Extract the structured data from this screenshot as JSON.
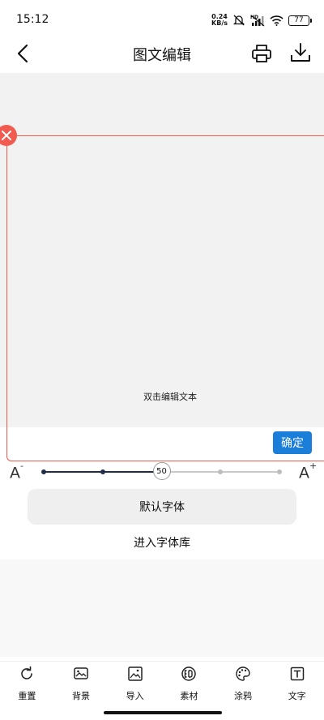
{
  "status_bar": {
    "time": "15:12",
    "net_speed_value": "0.24",
    "net_speed_unit": "KB/s",
    "battery": "77"
  },
  "header": {
    "title": "图文编辑",
    "icons": [
      "back-arrow-icon",
      "printer-icon",
      "download-icon"
    ]
  },
  "canvas": {
    "placeholder_text": "双击编辑文本",
    "border_color": "#ef5a4c",
    "background": "#f2f2f2"
  },
  "confirm_label": "确定",
  "font_size": {
    "value": 50,
    "min": 0,
    "max": 100,
    "ticks": [
      0,
      25,
      50,
      75,
      100
    ],
    "decrease_label": "A",
    "decrease_mark": "-",
    "increase_label": "A",
    "increase_mark": "+"
  },
  "font": {
    "current_label": "默认字体",
    "library_link": "进入字体库"
  },
  "toolbar": {
    "items": [
      {
        "label": "重置",
        "icon": "reset-icon"
      },
      {
        "label": "背景",
        "icon": "background-icon"
      },
      {
        "label": "导入",
        "icon": "import-image-icon"
      },
      {
        "label": "素材",
        "icon": "material-icon"
      },
      {
        "label": "涂鸦",
        "icon": "palette-icon"
      },
      {
        "label": "文字",
        "icon": "text-icon"
      }
    ]
  },
  "colors": {
    "accent": "#1b7ed8",
    "slider_active": "#1f2c4a",
    "delete": "#f25b50"
  }
}
